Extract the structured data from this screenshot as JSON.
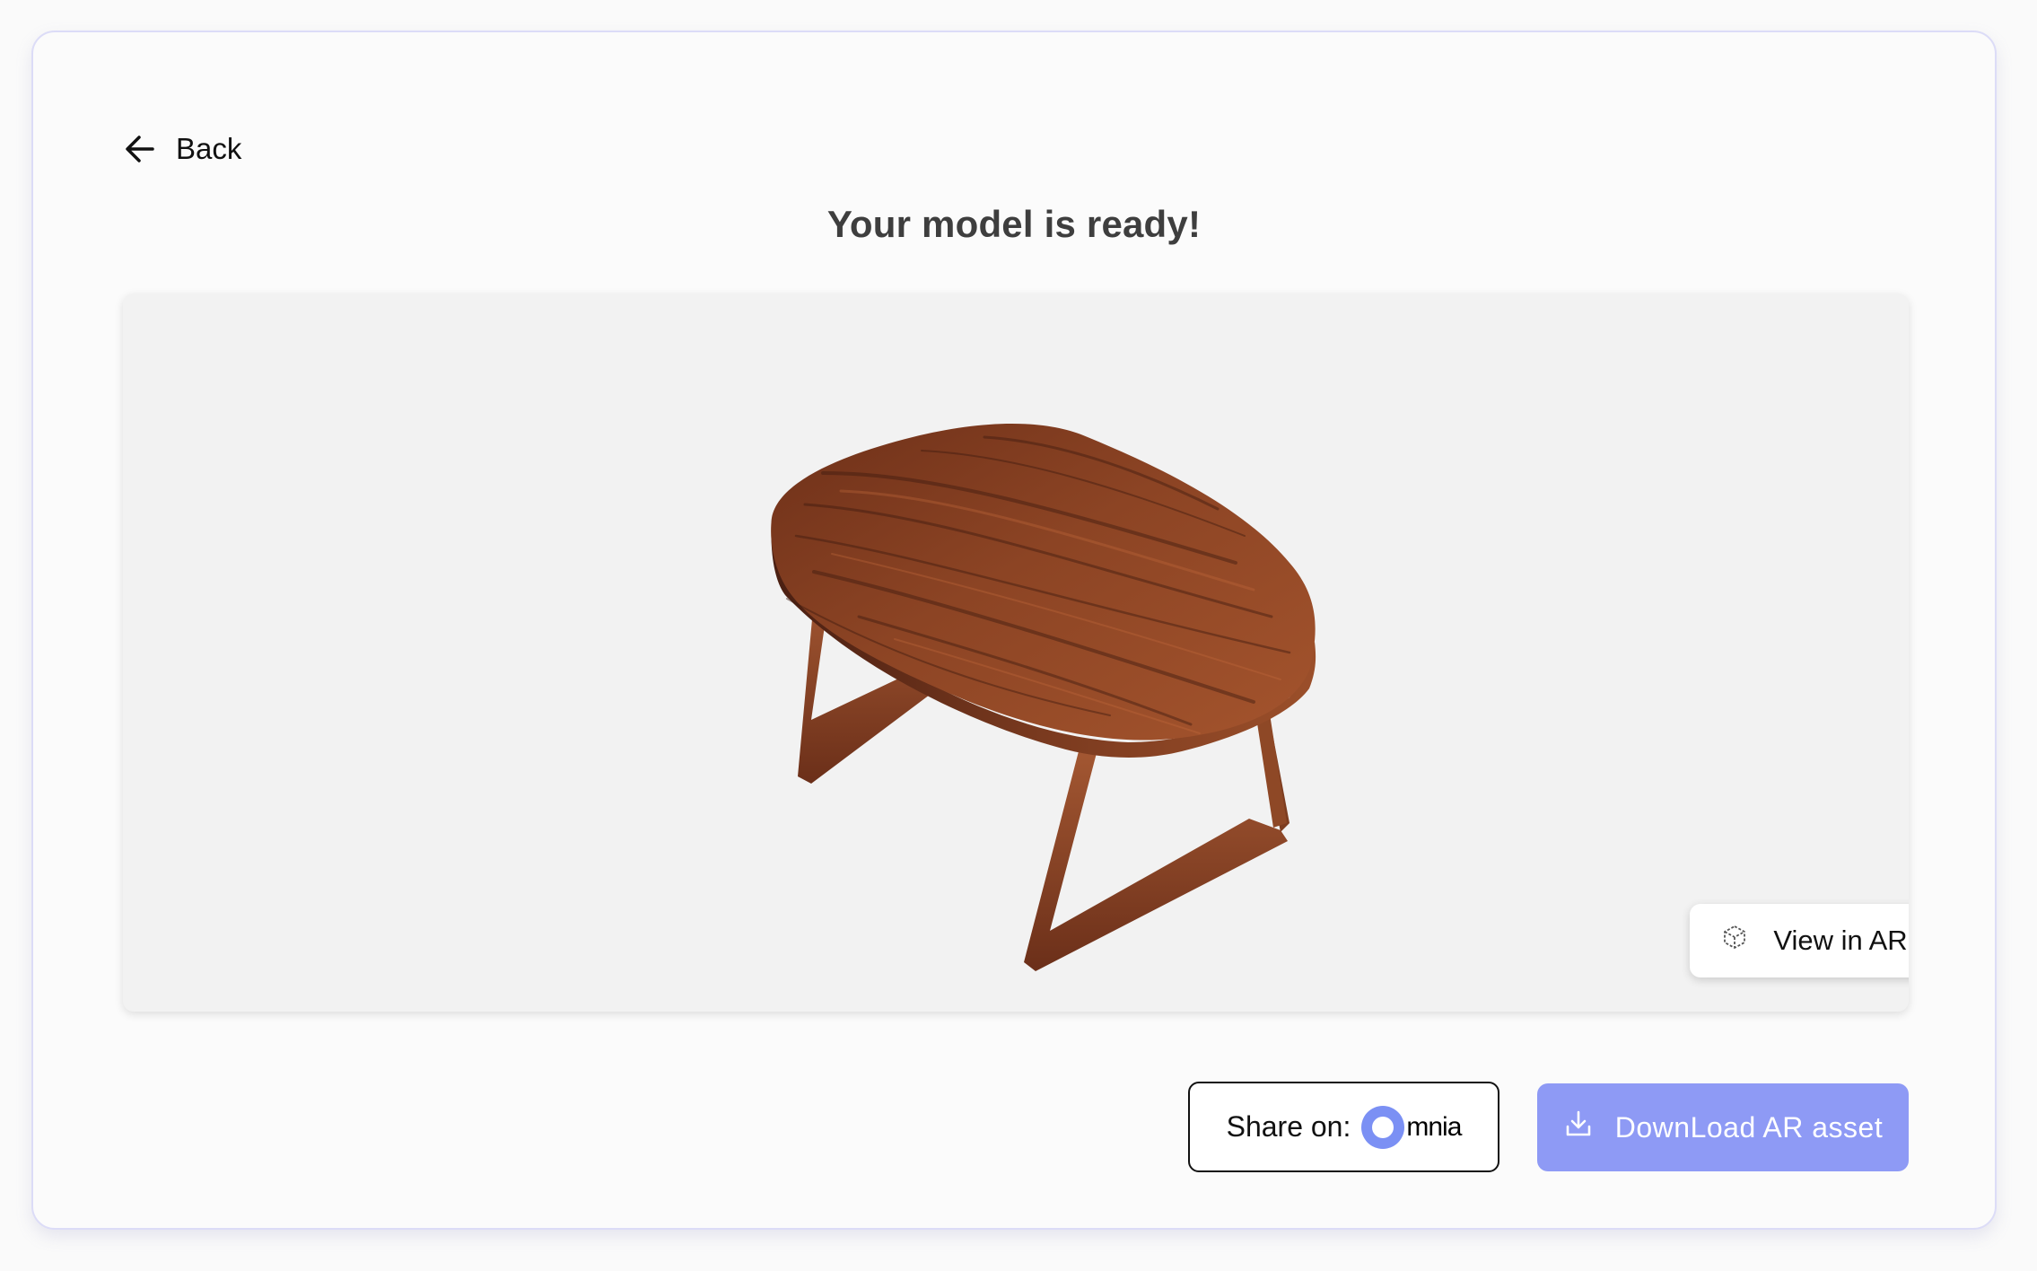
{
  "nav": {
    "back_label": "Back",
    "back_icon": "arrow-left-icon"
  },
  "page": {
    "title": "Your model is ready!"
  },
  "viewer": {
    "model_icon": "wooden-table-model",
    "ar_button_label": "View in AR",
    "ar_icon": "cube-icon"
  },
  "actions": {
    "share_label": "Share on:",
    "share_brand_text": "mnia",
    "share_brand_icon": "omnia-logo-icon",
    "download_label": "DownLoad AR asset",
    "download_icon": "download-icon"
  },
  "colors": {
    "accent": "#8e9af5",
    "brand": "#7b90f4",
    "wood": "#8b3f22"
  }
}
